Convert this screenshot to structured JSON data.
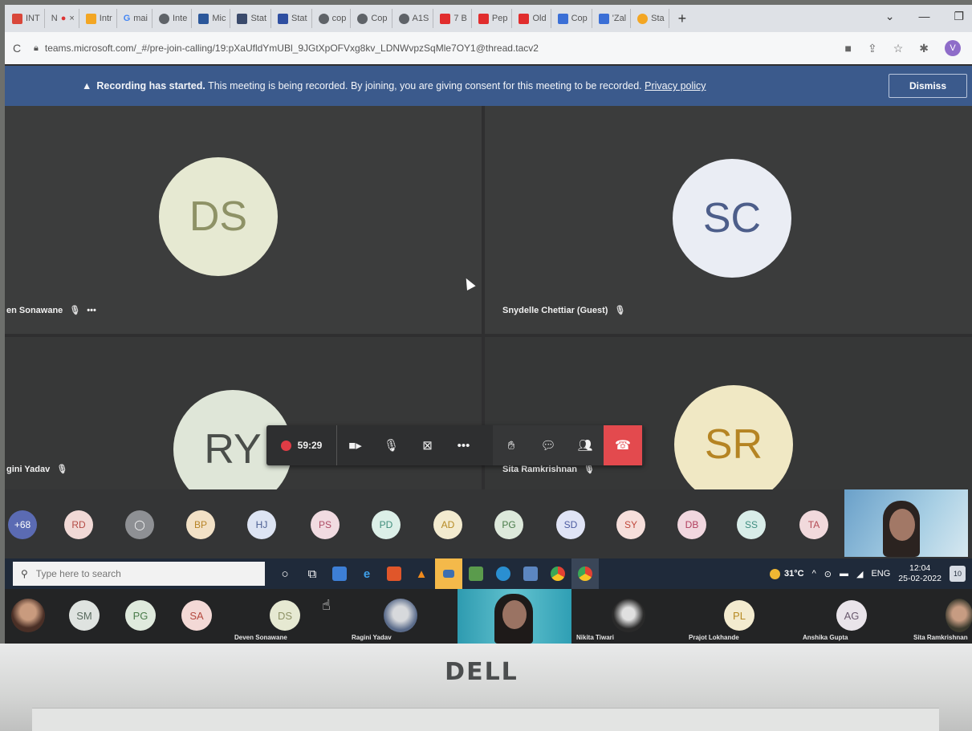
{
  "browser": {
    "tabs": [
      {
        "label": "INT",
        "color": "#d9473a"
      },
      {
        "label": "N",
        "color": "#c0392b"
      },
      {
        "label": "Intr",
        "color": "#f3a623"
      },
      {
        "label": "mai",
        "color": "#4285f4"
      },
      {
        "label": "Inte",
        "color": "#5f6368"
      },
      {
        "label": "Mic",
        "color": "#2b579a"
      },
      {
        "label": "Stat",
        "color": "#3a4a6b"
      },
      {
        "label": "Stat",
        "color": "#2f4fa1"
      },
      {
        "label": "cop",
        "color": "#5f6368"
      },
      {
        "label": "Cop",
        "color": "#5f6368"
      },
      {
        "label": "A1S",
        "color": "#5f6368"
      },
      {
        "label": "7 B",
        "color": "#e12d2d"
      },
      {
        "label": "Pep",
        "color": "#e12d2d"
      },
      {
        "label": "Old",
        "color": "#e12d2d"
      },
      {
        "label": "Cop",
        "color": "#3b6fd6"
      },
      {
        "label": "'Zal",
        "color": "#3b6fd6"
      },
      {
        "label": "Sta",
        "color": "#f3a623"
      }
    ],
    "new_tab": "+",
    "url": "teams.microsoft.com/_#/pre-join-calling/19:pXaUfldYmUBl_9JGtXpOFVxg8kv_LDNWvpzSqMle7OY1@thread.tacv2",
    "profile_initial": "V"
  },
  "banner": {
    "bold": "Recording has started.",
    "text": " This meeting is being recorded. By joining, you are giving consent for this meeting to be recorded. ",
    "link": "Privacy policy",
    "dismiss": "Dismiss"
  },
  "tiles": [
    {
      "initials": "DS",
      "name": "en Sonawane"
    },
    {
      "initials": "SC",
      "name": "Snydelle Chettiar (Guest)"
    },
    {
      "initials": "RY",
      "name": "gini Yadav"
    },
    {
      "initials": "SR",
      "name": "Sita Ramkrishnan"
    }
  ],
  "callbar": {
    "timer": "59:29"
  },
  "participants": [
    {
      "initials": "+68",
      "bg": "#5b6bb3",
      "fg": "#ffffff"
    },
    {
      "initials": "RD",
      "bg": "#f1d9d6",
      "fg": "#b44b45"
    },
    {
      "initials": "",
      "bg": "#8e9094",
      "fg": "#ffffff"
    },
    {
      "initials": "BP",
      "bg": "#f2e1c6",
      "fg": "#b78427"
    },
    {
      "initials": "HJ",
      "bg": "#dde4f3",
      "fg": "#4a5d92"
    },
    {
      "initials": "PS",
      "bg": "#f1dbe1",
      "fg": "#ad4d65"
    },
    {
      "initials": "PD",
      "bg": "#dcefe8",
      "fg": "#3f8d7b"
    },
    {
      "initials": "AD",
      "bg": "#f3ebcf",
      "fg": "#b68a23"
    },
    {
      "initials": "PG",
      "bg": "#dde9db",
      "fg": "#4a7c4a"
    },
    {
      "initials": "SD",
      "bg": "#e0e4f6",
      "fg": "#4d5ba0"
    },
    {
      "initials": "SY",
      "bg": "#f6dfdb",
      "fg": "#c0493c"
    },
    {
      "initials": "DB",
      "bg": "#f1d7df",
      "fg": "#b13e5e"
    },
    {
      "initials": "SS",
      "bg": "#d9ede9",
      "fg": "#3f8d80"
    },
    {
      "initials": "TA",
      "bg": "#f1d9dc",
      "fg": "#b44b55"
    }
  ],
  "taskbar": {
    "search_placeholder": "Type here to search",
    "temperature": "31°C",
    "language": "ENG",
    "time": "12:04",
    "date": "25-02-2022",
    "notifications": "10"
  },
  "strip2": {
    "chips": [
      {
        "initials": "SM",
        "bg": "#dfe3e0",
        "fg": "#5a6a5f"
      },
      {
        "initials": "PG",
        "bg": "#dfeadd",
        "fg": "#4a7c4a"
      },
      {
        "initials": "SA",
        "bg": "#f3d9d6",
        "fg": "#b4493f"
      },
      {
        "initials": "DS",
        "bg": "#e6e9d2",
        "fg": "#8e9266"
      },
      {
        "initials": "PL",
        "bg": "#f3ebcf",
        "fg": "#b68a23"
      },
      {
        "initials": "AG",
        "bg": "#e9e4ea",
        "fg": "#6a5a6e"
      }
    ],
    "names": [
      "Deven Sonawane",
      "Ragini Yadav",
      "Nikita Tiwari",
      "Prajot Lokhande",
      "Anshika Gupta",
      "Sita Ramkrishnan"
    ]
  },
  "monitor": {
    "brand": "DELL"
  }
}
